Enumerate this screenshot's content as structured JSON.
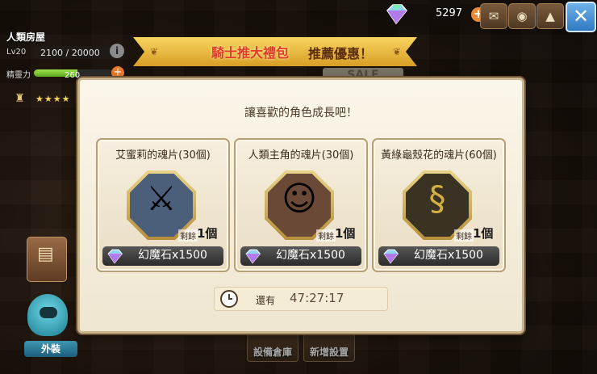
{
  "status": {
    "name": "人類房屋",
    "level": "Lv20",
    "exp": "2100 / 20000",
    "stamina_label": "精靈力",
    "stamina_value": "260",
    "stamina_fill": 0.55,
    "stars": "★★★★"
  },
  "currency": {
    "gems": "5297"
  },
  "banner": {
    "highlight": "騎士推大禮包",
    "text": "推薦優惠！",
    "sale_sign": "SALE"
  },
  "modal": {
    "title": "讓喜歡的角色成長吧！",
    "cards": [
      {
        "title": "艾蜜莉的魂片(30個)",
        "remaining_label": "剩餘",
        "remaining": "1個",
        "price": "幻魔石x1500",
        "portrait": "knight-girl-portrait",
        "bg": "#4b5e7a"
      },
      {
        "title": "人類主角的魂片(30個)",
        "remaining_label": "剩餘",
        "remaining": "1個",
        "price": "幻魔石x1500",
        "portrait": "human-heroes-portrait",
        "bg": "#6a4a36"
      },
      {
        "title": "黃綠龜殼花的魂片(60個)",
        "remaining_label": "剩餘",
        "remaining": "1個",
        "price": "幻魔石x1500",
        "portrait": "snake-portrait",
        "bg": "#3a3324"
      }
    ],
    "timer_label": "還有",
    "timer_value": "47:27:17"
  },
  "side": {
    "outfit_label": "外裝"
  },
  "bottom": {
    "storage_label": "設備倉庫",
    "new_label": "新增設置"
  },
  "colors": {
    "accent": "#e98a3a",
    "modal_bg": "#fbf6ea",
    "ribbon": "#f7d560"
  }
}
